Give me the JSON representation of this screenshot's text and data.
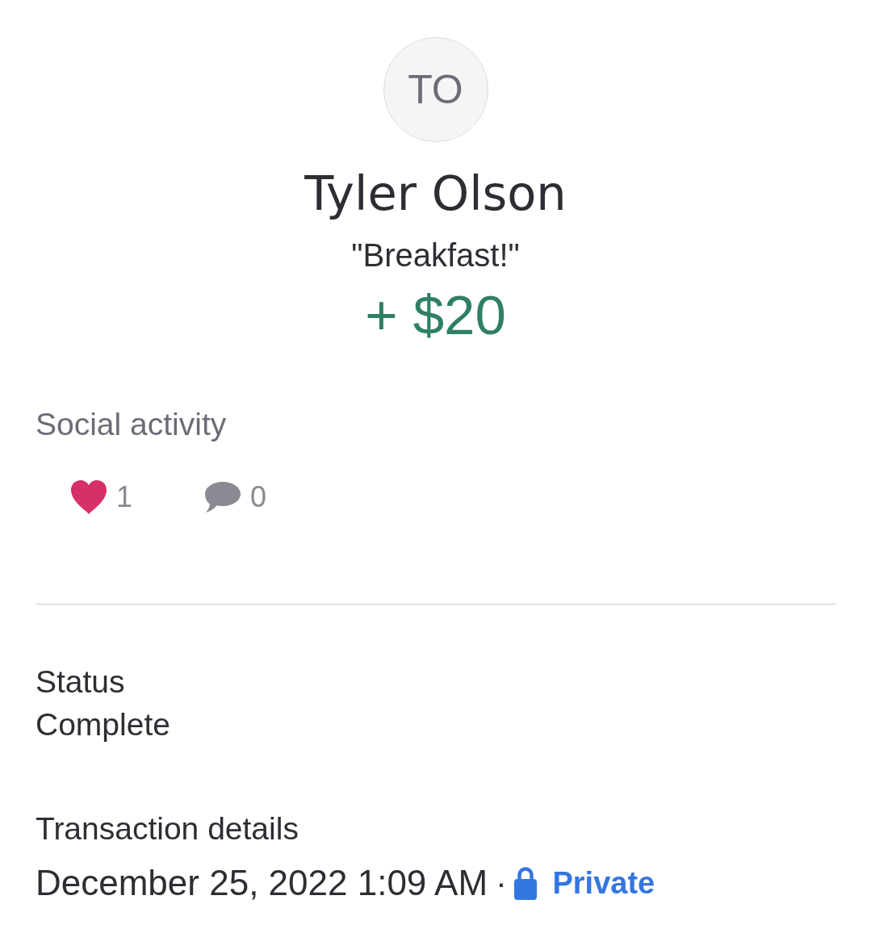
{
  "avatar": {
    "initials": "TO"
  },
  "payment": {
    "name": "Tyler Olson",
    "note": "\"Breakfast!\"",
    "amount": "+ $20",
    "incoming": true
  },
  "social": {
    "heading": "Social activity",
    "likes": {
      "count": "1",
      "liked": true
    },
    "comments": {
      "count": "0"
    }
  },
  "status": {
    "label": "Status",
    "value": "Complete"
  },
  "details": {
    "heading": "Transaction details",
    "date": "December 25, 2022 1:09 AM",
    "separator": "·",
    "privacy": "Private"
  }
}
